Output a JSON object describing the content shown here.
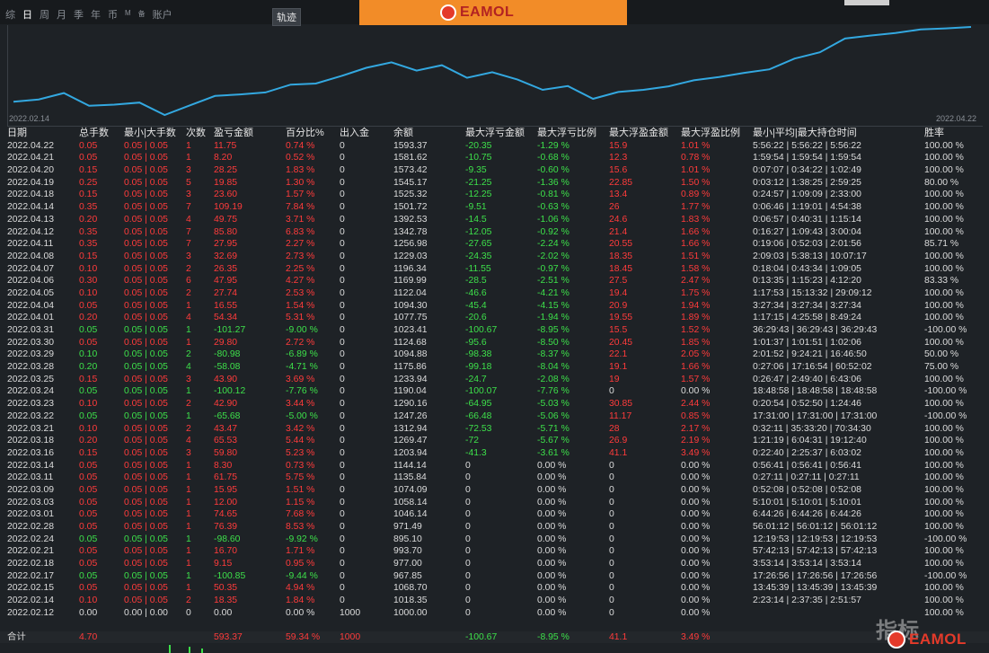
{
  "topbar": {
    "periods": [
      "综",
      "日",
      "周",
      "月",
      "季",
      "年",
      "币",
      "M",
      "备",
      "账户"
    ],
    "active_period": "日",
    "track_label": "轨迹",
    "brand": "EAMOL"
  },
  "chart": {
    "start_date": "2022.02.14",
    "end_date": "2022.04.22",
    "line_color": "#33a8e0"
  },
  "table": {
    "headers": [
      "日期",
      "总手数",
      "最小|大手数",
      "次数",
      "盈亏金额",
      "百分比%",
      "出入金",
      "余额",
      "最大浮亏金额",
      "最大浮亏比例",
      "最大浮盈金额",
      "最大浮盈比例",
      "最小|平均|最大持仓时间",
      "胜率"
    ],
    "rows": [
      [
        "2022.04.22",
        "0.05",
        "0.05 | 0.05",
        "1",
        "11.75",
        "0.74 %",
        "0",
        "1593.37",
        "-20.35",
        "-1.29 %",
        "15.9",
        "1.01 %",
        "5:56:22 | 5:56:22 | 5:56:22",
        "100.00 %"
      ],
      [
        "2022.04.21",
        "0.05",
        "0.05 | 0.05",
        "1",
        "8.20",
        "0.52 %",
        "0",
        "1581.62",
        "-10.75",
        "-0.68 %",
        "12.3",
        "0.78 %",
        "1:59:54 | 1:59:54 | 1:59:54",
        "100.00 %"
      ],
      [
        "2022.04.20",
        "0.15",
        "0.05 | 0.05",
        "3",
        "28.25",
        "1.83 %",
        "0",
        "1573.42",
        "-9.35",
        "-0.60 %",
        "15.6",
        "1.01 %",
        "0:07:07 | 0:34:22 | 1:02:49",
        "100.00 %"
      ],
      [
        "2022.04.19",
        "0.25",
        "0.05 | 0.05",
        "5",
        "19.85",
        "1.30 %",
        "0",
        "1545.17",
        "-21.25",
        "-1.36 %",
        "22.85",
        "1.50 %",
        "0:03:12 | 1:38:25 | 2:59:25",
        "80.00 %"
      ],
      [
        "2022.04.18",
        "0.15",
        "0.05 | 0.05",
        "3",
        "23.60",
        "1.57 %",
        "0",
        "1525.32",
        "-12.25",
        "-0.81 %",
        "13.4",
        "0.89 %",
        "0:24:57 | 1:09:09 | 2:33:00",
        "100.00 %"
      ],
      [
        "2022.04.14",
        "0.35",
        "0.05 | 0.05",
        "7",
        "109.19",
        "7.84 %",
        "0",
        "1501.72",
        "-9.51",
        "-0.63 %",
        "26",
        "1.77 %",
        "0:06:46 | 1:19:01 | 4:54:38",
        "100.00 %"
      ],
      [
        "2022.04.13",
        "0.20",
        "0.05 | 0.05",
        "4",
        "49.75",
        "3.71 %",
        "0",
        "1392.53",
        "-14.5",
        "-1.06 %",
        "24.6",
        "1.83 %",
        "0:06:57 | 0:40:31 | 1:15:14",
        "100.00 %"
      ],
      [
        "2022.04.12",
        "0.35",
        "0.05 | 0.05",
        "7",
        "85.80",
        "6.83 %",
        "0",
        "1342.78",
        "-12.05",
        "-0.92 %",
        "21.4",
        "1.66 %",
        "0:16:27 | 1:09:43 | 3:00:04",
        "100.00 %"
      ],
      [
        "2022.04.11",
        "0.35",
        "0.05 | 0.05",
        "7",
        "27.95",
        "2.27 %",
        "0",
        "1256.98",
        "-27.65",
        "-2.24 %",
        "20.55",
        "1.66 %",
        "0:19:06 | 0:52:03 | 2:01:56",
        "85.71 %"
      ],
      [
        "2022.04.08",
        "0.15",
        "0.05 | 0.05",
        "3",
        "32.69",
        "2.73 %",
        "0",
        "1229.03",
        "-24.35",
        "-2.02 %",
        "18.35",
        "1.51 %",
        "2:09:03 | 5:38:13 | 10:07:17",
        "100.00 %"
      ],
      [
        "2022.04.07",
        "0.10",
        "0.05 | 0.05",
        "2",
        "26.35",
        "2.25 %",
        "0",
        "1196.34",
        "-11.55",
        "-0.97 %",
        "18.45",
        "1.58 %",
        "0:18:04 | 0:43:34 | 1:09:05",
        "100.00 %"
      ],
      [
        "2022.04.06",
        "0.30",
        "0.05 | 0.05",
        "6",
        "47.95",
        "4.27 %",
        "0",
        "1169.99",
        "-28.5",
        "-2.51 %",
        "27.5",
        "2.47 %",
        "0:13:35 | 1:15:23 | 4:12:20",
        "83.33 %"
      ],
      [
        "2022.04.05",
        "0.10",
        "0.05 | 0.05",
        "2",
        "27.74",
        "2.53 %",
        "0",
        "1122.04",
        "-46.6",
        "-4.21 %",
        "19.4",
        "1.75 %",
        "1:17:53 | 15:13:32 | 29:09:12",
        "100.00 %"
      ],
      [
        "2022.04.04",
        "0.05",
        "0.05 | 0.05",
        "1",
        "16.55",
        "1.54 %",
        "0",
        "1094.30",
        "-45.4",
        "-4.15 %",
        "20.9",
        "1.94 %",
        "3:27:34 | 3:27:34 | 3:27:34",
        "100.00 %"
      ],
      [
        "2022.04.01",
        "0.20",
        "0.05 | 0.05",
        "4",
        "54.34",
        "5.31 %",
        "0",
        "1077.75",
        "-20.6",
        "-1.94 %",
        "19.55",
        "1.89 %",
        "1:17:15 | 4:25:58 | 8:49:24",
        "100.00 %"
      ],
      [
        "2022.03.31",
        "0.05",
        "0.05 | 0.05",
        "1",
        "-101.27",
        "-9.00 %",
        "0",
        "1023.41",
        "-100.67",
        "-8.95 %",
        "15.5",
        "1.52 %",
        "36:29:43 | 36:29:43 | 36:29:43",
        "-100.00 %"
      ],
      [
        "2022.03.30",
        "0.05",
        "0.05 | 0.05",
        "1",
        "29.80",
        "2.72 %",
        "0",
        "1124.68",
        "-95.6",
        "-8.50 %",
        "20.45",
        "1.85 %",
        "1:01:37 | 1:01:51 | 1:02:06",
        "100.00 %"
      ],
      [
        "2022.03.29",
        "0.10",
        "0.05 | 0.05",
        "2",
        "-80.98",
        "-6.89 %",
        "0",
        "1094.88",
        "-98.38",
        "-8.37 %",
        "22.1",
        "2.05 %",
        "2:01:52 | 9:24:21 | 16:46:50",
        "50.00 %"
      ],
      [
        "2022.03.28",
        "0.20",
        "0.05 | 0.05",
        "4",
        "-58.08",
        "-4.71 %",
        "0",
        "1175.86",
        "-99.18",
        "-8.04 %",
        "19.1",
        "1.66 %",
        "0:27:06 | 17:16:54 | 60:52:02",
        "75.00 %"
      ],
      [
        "2022.03.25",
        "0.15",
        "0.05 | 0.05",
        "3",
        "43.90",
        "3.69 %",
        "0",
        "1233.94",
        "-24.7",
        "-2.08 %",
        "19",
        "1.57 %",
        "0:26:47 | 2:49:40 | 6:43:06",
        "100.00 %"
      ],
      [
        "2022.03.24",
        "0.05",
        "0.05 | 0.05",
        "1",
        "-100.12",
        "-7.76 %",
        "0",
        "1190.04",
        "-100.07",
        "-7.76 %",
        "0",
        "0.00 %",
        "18:48:58 | 18:48:58 | 18:48:58",
        "-100.00 %"
      ],
      [
        "2022.03.23",
        "0.10",
        "0.05 | 0.05",
        "2",
        "42.90",
        "3.44 %",
        "0",
        "1290.16",
        "-64.95",
        "-5.03 %",
        "30.85",
        "2.44 %",
        "0:20:54 | 0:52:50 | 1:24:46",
        "100.00 %"
      ],
      [
        "2022.03.22",
        "0.05",
        "0.05 | 0.05",
        "1",
        "-65.68",
        "-5.00 %",
        "0",
        "1247.26",
        "-66.48",
        "-5.06 %",
        "11.17",
        "0.85 %",
        "17:31:00 | 17:31:00 | 17:31:00",
        "-100.00 %"
      ],
      [
        "2022.03.21",
        "0.10",
        "0.05 | 0.05",
        "2",
        "43.47",
        "3.42 %",
        "0",
        "1312.94",
        "-72.53",
        "-5.71 %",
        "28",
        "2.17 %",
        "0:32:11 | 35:33:20 | 70:34:30",
        "100.00 %"
      ],
      [
        "2022.03.18",
        "0.20",
        "0.05 | 0.05",
        "4",
        "65.53",
        "5.44 %",
        "0",
        "1269.47",
        "-72",
        "-5.67 %",
        "26.9",
        "2.19 %",
        "1:21:19 | 6:04:31 | 19:12:40",
        "100.00 %"
      ],
      [
        "2022.03.16",
        "0.15",
        "0.05 | 0.05",
        "3",
        "59.80",
        "5.23 %",
        "0",
        "1203.94",
        "-41.3",
        "-3.61 %",
        "41.1",
        "3.49 %",
        "0:22:40 | 2:25:37 | 6:03:02",
        "100.00 %"
      ],
      [
        "2022.03.14",
        "0.05",
        "0.05 | 0.05",
        "1",
        "8.30",
        "0.73 %",
        "0",
        "1144.14",
        "0",
        "0.00 %",
        "0",
        "0.00 %",
        "0:56:41 | 0:56:41 | 0:56:41",
        "100.00 %"
      ],
      [
        "2022.03.11",
        "0.05",
        "0.05 | 0.05",
        "1",
        "61.75",
        "5.75 %",
        "0",
        "1135.84",
        "0",
        "0.00 %",
        "0",
        "0.00 %",
        "0:27:11 | 0:27:11 | 0:27:11",
        "100.00 %"
      ],
      [
        "2022.03.09",
        "0.05",
        "0.05 | 0.05",
        "1",
        "15.95",
        "1.51 %",
        "0",
        "1074.09",
        "0",
        "0.00 %",
        "0",
        "0.00 %",
        "0:52:08 | 0:52:08 | 0:52:08",
        "100.00 %"
      ],
      [
        "2022.03.03",
        "0.05",
        "0.05 | 0.05",
        "1",
        "12.00",
        "1.15 %",
        "0",
        "1058.14",
        "0",
        "0.00 %",
        "0",
        "0.00 %",
        "5:10:01 | 5:10:01 | 5:10:01",
        "100.00 %"
      ],
      [
        "2022.03.01",
        "0.05",
        "0.05 | 0.05",
        "1",
        "74.65",
        "7.68 %",
        "0",
        "1046.14",
        "0",
        "0.00 %",
        "0",
        "0.00 %",
        "6:44:26 | 6:44:26 | 6:44:26",
        "100.00 %"
      ],
      [
        "2022.02.28",
        "0.05",
        "0.05 | 0.05",
        "1",
        "76.39",
        "8.53 %",
        "0",
        "971.49",
        "0",
        "0.00 %",
        "0",
        "0.00 %",
        "56:01:12 | 56:01:12 | 56:01:12",
        "100.00 %"
      ],
      [
        "2022.02.24",
        "0.05",
        "0.05 | 0.05",
        "1",
        "-98.60",
        "-9.92 %",
        "0",
        "895.10",
        "0",
        "0.00 %",
        "0",
        "0.00 %",
        "12:19:53 | 12:19:53 | 12:19:53",
        "-100.00 %"
      ],
      [
        "2022.02.21",
        "0.05",
        "0.05 | 0.05",
        "1",
        "16.70",
        "1.71 %",
        "0",
        "993.70",
        "0",
        "0.00 %",
        "0",
        "0.00 %",
        "57:42:13 | 57:42:13 | 57:42:13",
        "100.00 %"
      ],
      [
        "2022.02.18",
        "0.05",
        "0.05 | 0.05",
        "1",
        "9.15",
        "0.95 %",
        "0",
        "977.00",
        "0",
        "0.00 %",
        "0",
        "0.00 %",
        "3:53:14 | 3:53:14 | 3:53:14",
        "100.00 %"
      ],
      [
        "2022.02.17",
        "0.05",
        "0.05 | 0.05",
        "1",
        "-100.85",
        "-9.44 %",
        "0",
        "967.85",
        "0",
        "0.00 %",
        "0",
        "0.00 %",
        "17:26:56 | 17:26:56 | 17:26:56",
        "-100.00 %"
      ],
      [
        "2022.02.15",
        "0.05",
        "0.05 | 0.05",
        "1",
        "50.35",
        "4.94 %",
        "0",
        "1068.70",
        "0",
        "0.00 %",
        "0",
        "0.00 %",
        "13:45:39 | 13:45:39 | 13:45:39",
        "100.00 %"
      ],
      [
        "2022.02.14",
        "0.10",
        "0.05 | 0.05",
        "2",
        "18.35",
        "1.84 %",
        "0",
        "1018.35",
        "0",
        "0.00 %",
        "0",
        "0.00 %",
        "2:23:14 | 2:37:35 | 2:51:57",
        "100.00 %"
      ],
      [
        "2022.02.12",
        "0.00",
        "0.00 | 0.00",
        "0",
        "0.00",
        "0.00 %",
        "1000",
        "1000.00",
        "0",
        "0.00 %",
        "0",
        "0.00 %",
        "",
        "100.00 %"
      ]
    ],
    "total": {
      "label": "合计",
      "lots": "4.70",
      "pnl": "593.37",
      "percent": "59.34 %",
      "deposit": "1000",
      "max_dd": "-100.67",
      "max_dd_pct": "-8.95 %",
      "max_gain": "41.1",
      "max_gain_pct": "3.49 %"
    }
  },
  "watermark": "指标",
  "footer_brand": "EAMOL"
}
